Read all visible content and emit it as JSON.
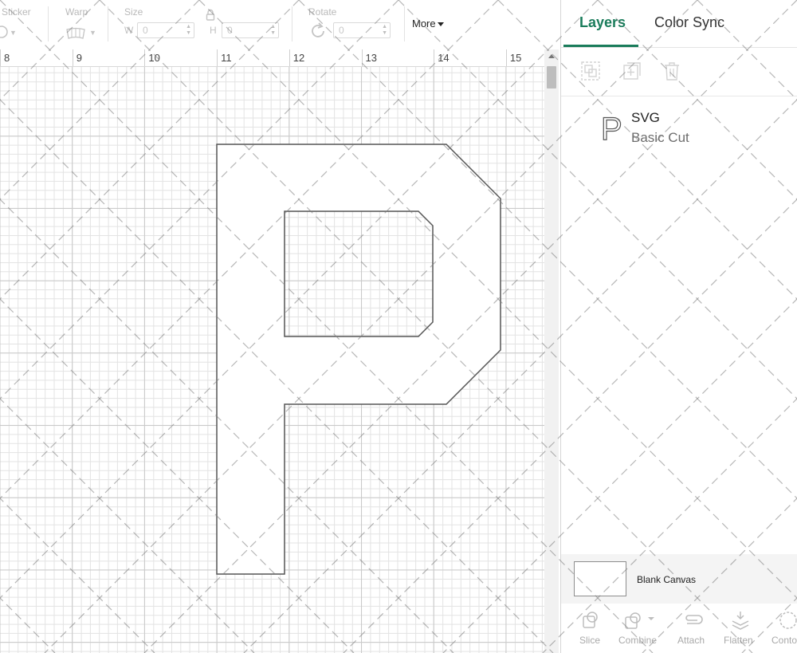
{
  "toolbar": {
    "sticker_label": "Sticker",
    "warp_label": "Warp",
    "size_label": "Size",
    "width_label": "W",
    "width_value": "0",
    "height_label": "H",
    "height_value": "0",
    "rotate_label": "Rotate",
    "rotate_value": "0",
    "more_label": "More"
  },
  "ruler": {
    "numbers": [
      "8",
      "9",
      "10",
      "11",
      "12",
      "13",
      "14",
      "15"
    ]
  },
  "panel": {
    "tabs": [
      {
        "label": "Layers",
        "active": true
      },
      {
        "label": "Color Sync",
        "active": false
      }
    ],
    "layer": {
      "thumbnail_glyph": "P",
      "name": "SVG",
      "type": "Basic Cut"
    },
    "canvas_row": {
      "label": "Blank Canvas"
    },
    "bottom_actions": [
      {
        "label": "Slice",
        "icon": "slice-icon"
      },
      {
        "label": "Combine",
        "icon": "combine-icon"
      },
      {
        "label": "Attach",
        "icon": "attach-icon"
      },
      {
        "label": "Flatten",
        "icon": "flatten-icon"
      },
      {
        "label": "Conto",
        "icon": "contour-icon"
      }
    ]
  },
  "colors": {
    "accent": "#1a7c5b",
    "grid_minor": "#e3e3e3",
    "grid_major": "#c9c9c9",
    "shape_stroke": "#555555"
  },
  "icons": {
    "group": "group-icon",
    "duplicate": "duplicate-icon",
    "delete": "delete-icon",
    "lock": "lock-icon",
    "rotate": "rotate-icon",
    "warp": "warp-icon",
    "sticker": "sticker-icon"
  }
}
